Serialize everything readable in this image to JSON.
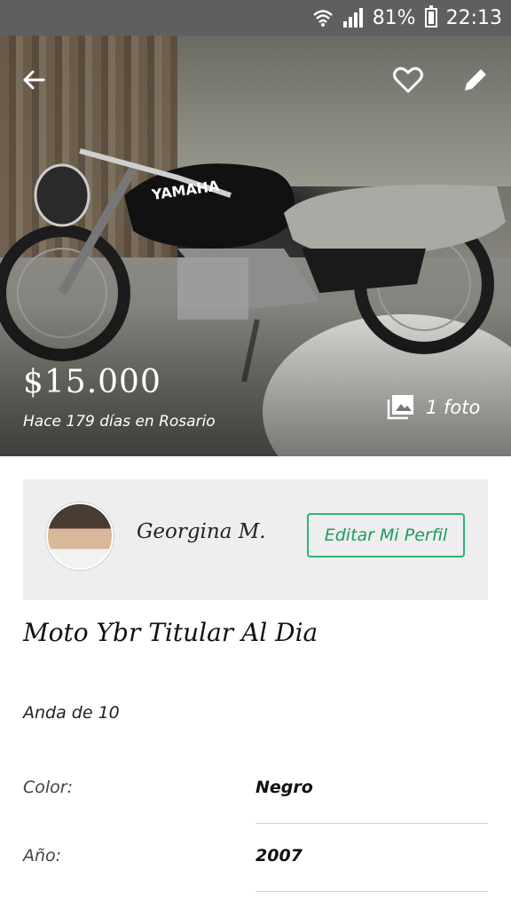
{
  "status_bar": {
    "battery": "81%",
    "time": "22:13",
    "icons": [
      "wifi-icon",
      "signal-icon",
      "battery-icon"
    ]
  },
  "listing": {
    "price": "$15.000",
    "subtitle": "Hace 179 días en Rosario",
    "photo_count": "1 foto",
    "title": "Moto Ybr Titular Al Dia",
    "description": "Anda de 10"
  },
  "seller": {
    "name": "Georgina M.",
    "edit_profile_label": "Editar Mi Perfil"
  },
  "attributes": [
    {
      "label": "Color:",
      "value": "Negro"
    },
    {
      "label": "Año:",
      "value": "2007"
    }
  ],
  "colors": {
    "accent": "#2bb673",
    "status_bar": "#5f5f5f",
    "card_bg": "#eeeeee"
  },
  "icons": {
    "back": "arrow-left-icon",
    "favorite": "heart-icon",
    "edit": "pencil-icon",
    "photos": "image-gallery-icon"
  }
}
